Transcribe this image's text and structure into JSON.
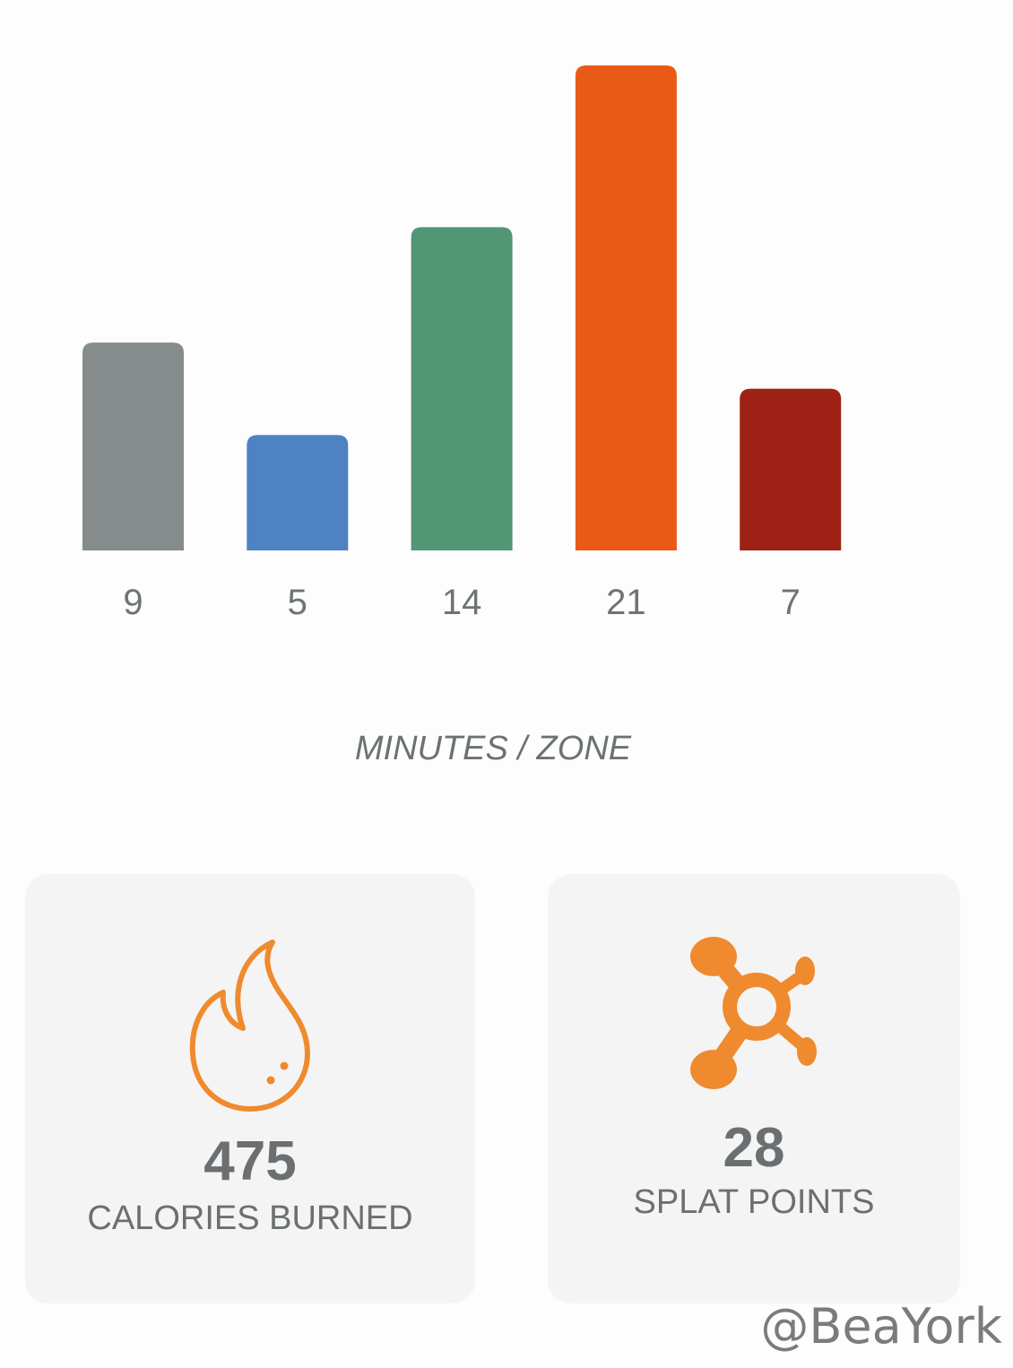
{
  "chart_data": {
    "type": "bar",
    "categories": [
      "9",
      "5",
      "14",
      "21",
      "7"
    ],
    "values": [
      9,
      5,
      14,
      21,
      7
    ],
    "colors": [
      "#858c8b",
      "#4e82c3",
      "#529675",
      "#ea5a17",
      "#9e2116"
    ],
    "xlabel": "MINUTES / ZONE",
    "ylabel": "",
    "ylim": [
      0,
      21
    ]
  },
  "stats": {
    "calories": {
      "value": "475",
      "label": "CALORIES BURNED",
      "icon": "flame-icon",
      "color": "#ef8a2e"
    },
    "splat": {
      "value": "28",
      "label": "SPLAT POINTS",
      "icon": "splat-logo-icon",
      "color": "#ef8a2e"
    }
  },
  "watermark": "@BeaYork"
}
